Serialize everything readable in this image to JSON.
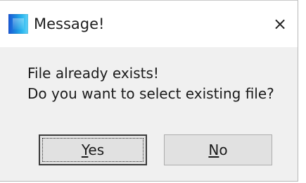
{
  "window": {
    "title": "Message!",
    "close_symbol": "×",
    "icon": "app-icon"
  },
  "message": {
    "lines": [
      "File already exists!",
      "Do you want to select existing file?"
    ]
  },
  "buttons": {
    "yes": {
      "mnemonic": "Y",
      "rest": "es"
    },
    "no": {
      "mnemonic": "N",
      "rest": "o"
    }
  }
}
